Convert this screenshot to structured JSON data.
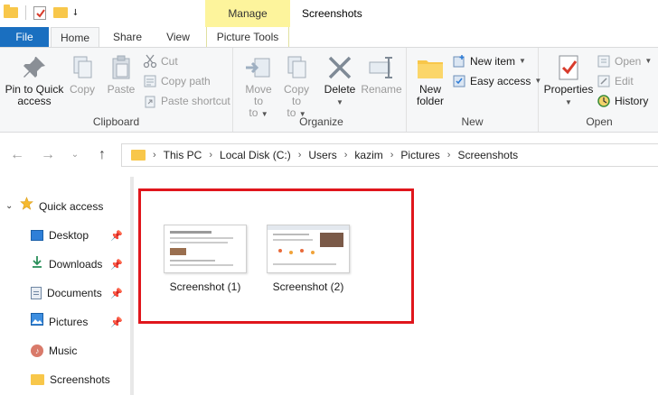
{
  "title_bar": {
    "manage_label": "Manage",
    "window_title": "Screenshots"
  },
  "tabs": {
    "file": "File",
    "home": "Home",
    "share": "Share",
    "view": "View",
    "picture_tools": "Picture Tools"
  },
  "ribbon": {
    "clipboard": {
      "label": "Clipboard",
      "pin_to_quick_access": "Pin to Quick access",
      "copy": "Copy",
      "paste": "Paste",
      "cut": "Cut",
      "copy_path": "Copy path",
      "paste_shortcut": "Paste shortcut"
    },
    "organize": {
      "label": "Organize",
      "move_to": "Move to",
      "copy_to": "Copy to",
      "delete": "Delete",
      "rename": "Rename",
      "dropdown_to": "to"
    },
    "new": {
      "label": "New",
      "new_folder": "New folder",
      "new_item": "New item",
      "easy_access": "Easy access"
    },
    "open": {
      "label": "Open",
      "properties": "Properties",
      "open": "Open",
      "edit": "Edit",
      "history": "History"
    }
  },
  "address_bar": {
    "segments": [
      "This PC",
      "Local Disk (C:)",
      "Users",
      "kazim",
      "Pictures",
      "Screenshots"
    ]
  },
  "nav_pane": {
    "quick_access": "Quick access",
    "items": [
      {
        "label": "Desktop",
        "icon": "desktop-icon",
        "pinned": true
      },
      {
        "label": "Downloads",
        "icon": "downloads-icon",
        "pinned": true
      },
      {
        "label": "Documents",
        "icon": "documents-icon",
        "pinned": true
      },
      {
        "label": "Pictures",
        "icon": "pictures-icon",
        "pinned": true
      },
      {
        "label": "Music",
        "icon": "music-icon",
        "pinned": false
      },
      {
        "label": "Screenshots",
        "icon": "folder-icon",
        "pinned": false
      }
    ]
  },
  "files": [
    {
      "name": "Screenshot (1)"
    },
    {
      "name": "Screenshot (2)"
    }
  ],
  "colors": {
    "file_tab": "#1a6fc0",
    "manage_highlight": "#fdf49c",
    "selection_box": "#e0161c",
    "folder_yellow": "#f8c74a"
  }
}
